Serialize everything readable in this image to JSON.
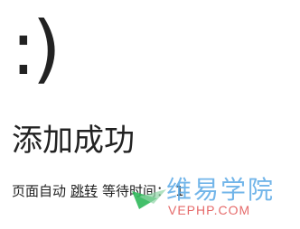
{
  "face": ":)",
  "title": "添加成功",
  "message": {
    "prefix": "页面自动",
    "link_label": "跳转",
    "middle": "等待时间：",
    "countdown": "1"
  },
  "watermark": {
    "brand_cn": "维易学院",
    "brand_en": "VEPHP.COM",
    "colors": {
      "green": "#2fb85a",
      "blue": "#5aa9e6",
      "red": "#e35a5a"
    }
  }
}
